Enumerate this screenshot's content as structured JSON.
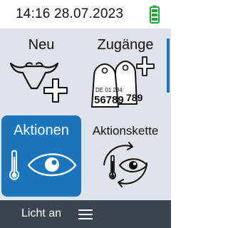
{
  "status": {
    "time": "14:16",
    "date": "28.07.2023",
    "time_date": "14:16 28.07.2023",
    "battery_icon": "battery-full-icon"
  },
  "tiles": [
    {
      "label": "Neu",
      "icon": "cow-plus-icon",
      "selected": false
    },
    {
      "label": "Zugänge",
      "icon": "ear-tags-plus-icon",
      "selected": false,
      "tag_front_line1": "DE 01 234",
      "tag_front_line2": "56789",
      "tag_back_line2": "789"
    },
    {
      "label": "Aktionen",
      "icon": "thermometer-eye-icon",
      "selected": true
    },
    {
      "label": "Aktionskette",
      "icon": "thermometer-eye-cycle-icon",
      "selected": false
    }
  ],
  "bottom": {
    "label": "Licht an",
    "menu_icon": "menu-icon"
  },
  "colors": {
    "accent": "#1b75bc",
    "background": "#dfe4ea",
    "bottom_bar": "#3c4350",
    "battery": "#2e9e3e"
  }
}
